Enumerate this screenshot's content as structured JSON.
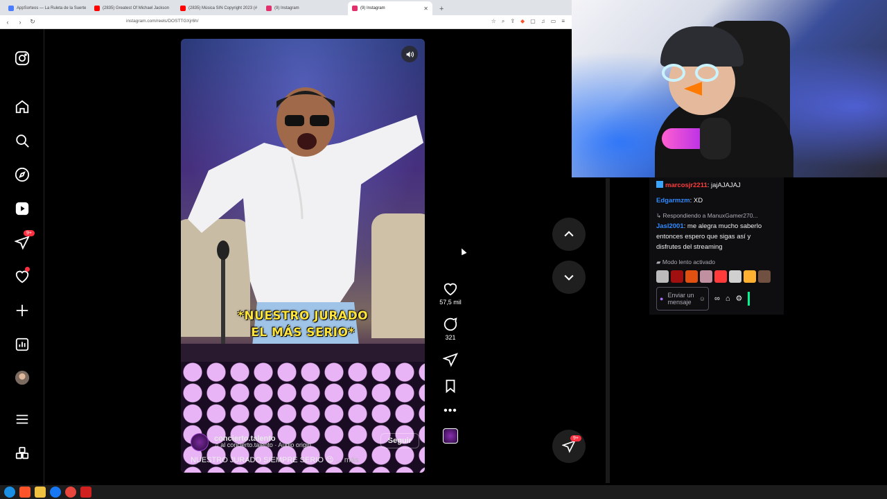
{
  "browser": {
    "tabs": [
      {
        "title": "AppSorteos — La Ruleta de la Suerte",
        "icon": "appsorteos-icon",
        "color": "#4a7cff",
        "active": false
      },
      {
        "title": "(2835) Greatest Of Michael Jackson",
        "icon": "youtube-icon",
        "color": "#ff0000",
        "active": false
      },
      {
        "title": "(2835) Música SIN Copyright 2023 (#",
        "icon": "youtube-icon",
        "color": "#ff0000",
        "active": false
      },
      {
        "title": "(9) Instagram",
        "icon": "instagram-icon",
        "color": "#e1306c",
        "active": false
      },
      {
        "title": "(9) Instagram",
        "icon": "instagram-icon",
        "color": "#e1306c",
        "active": true
      }
    ],
    "url": "instagram.com/reels/DOSTTGXjr6h/"
  },
  "instagram": {
    "sidebar_badge": "9+",
    "reel": {
      "overlay_line1": "*NUESTRO JURADO",
      "overlay_line2": "EL MÁS SERIO*",
      "author": "concierto.talento",
      "audio": "al    concierto.talento · Audio origin",
      "follow_label": "Seguir",
      "description": "NUESTRO JURADO SIEMPRE SERIO 😉",
      "more_label": "... más"
    },
    "actions": {
      "likes": "57,5 mil",
      "comments": "321"
    },
    "dm_badge": "9+"
  },
  "chat": {
    "messages": [
      {
        "user": "marcosjr2211",
        "user_color": "red",
        "text": ": jajAJAJAJ"
      },
      {
        "user": "Edgarmzm",
        "user_color": "blue",
        "text": ": XD"
      }
    ],
    "reply_context": "Respondiendo a ManuxGamer270...",
    "reply_message": {
      "user": "Jasl2001",
      "text": ": me alegra mucho saberlo entonces espero que sigas así y disfrutes del streaming"
    },
    "slow_mode": "Modo lento activado",
    "input_placeholder": "Enviar un mensaje"
  },
  "colors": {
    "ig_bg": "#000000",
    "like_badge": "#ff3040",
    "twitch_input_border": "#53535f"
  }
}
